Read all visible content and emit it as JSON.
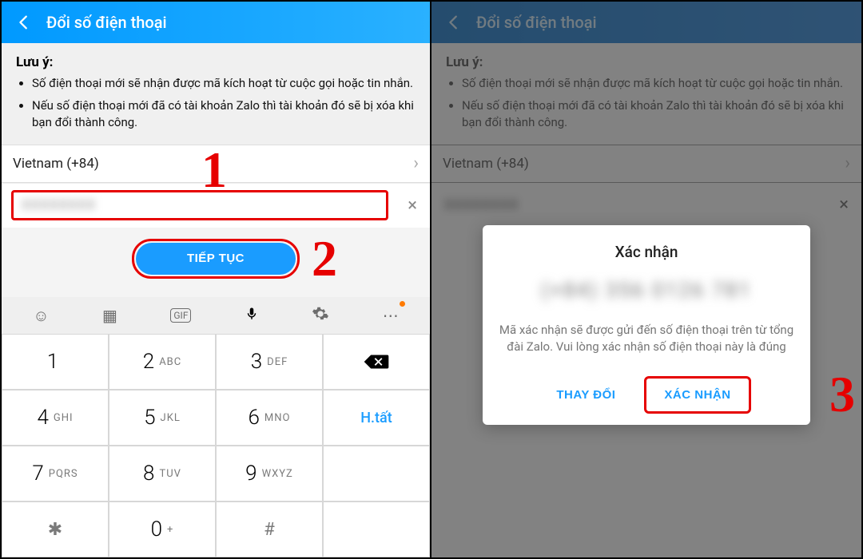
{
  "colors": {
    "accent": "#1a9cff",
    "annotation": "#e60000"
  },
  "header": {
    "title": "Đổi số điện thoại"
  },
  "notes": {
    "title": "Lưu ý:",
    "items": [
      "Số điện thoại mới sẽ nhận được mã kích hoạt từ cuộc gọi hoặc tin nhắn.",
      "Nếu số điện thoại mới đã có tài khoản Zalo thì tài khoản đó sẽ bị xóa khi bạn đổi thành công."
    ]
  },
  "country": {
    "label": "Vietnam (+84)"
  },
  "phone_input": {
    "masked": "XXXXXXXX"
  },
  "continue_button": {
    "label": "TIẾP TỤC"
  },
  "steps": {
    "s1": "1",
    "s2": "2",
    "s3": "3"
  },
  "keypad": {
    "done": "H.tất",
    "keys": [
      {
        "d": "1",
        "l": ""
      },
      {
        "d": "2",
        "l": "ABC"
      },
      {
        "d": "3",
        "l": "DEF"
      },
      {
        "d": "4",
        "l": "GHI"
      },
      {
        "d": "5",
        "l": "JKL"
      },
      {
        "d": "6",
        "l": "MNO"
      },
      {
        "d": "7",
        "l": "PQRS"
      },
      {
        "d": "8",
        "l": "TUV"
      },
      {
        "d": "9",
        "l": "WXYZ"
      },
      {
        "d": "0",
        "l": "+"
      }
    ],
    "star": "✱",
    "hash": "#"
  },
  "dialog": {
    "title": "Xác nhận",
    "masked_number": "(+84) 356 0126 781",
    "message": "Mã xác nhận sẽ được gửi đến số điện thoại trên từ tổng đài Zalo. Vui lòng xác nhận số điện thoại này là đúng",
    "change": "THAY ĐỔI",
    "confirm": "XÁC NHẬN"
  }
}
